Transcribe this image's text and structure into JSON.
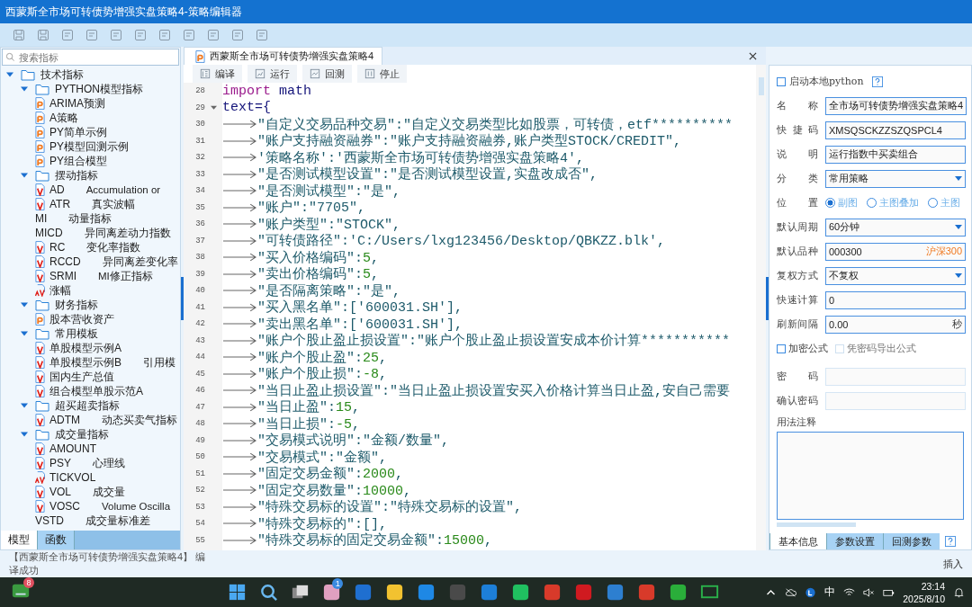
{
  "window": {
    "title": "西蒙斯全市场可转债势增强实盘策略4-策略编辑器"
  },
  "sidebar": {
    "search": {
      "placeholder": "搜索指标"
    },
    "tree": [
      {
        "label": "技术指标",
        "expanded": true,
        "children": [
          {
            "label": "PYTHON模型指标",
            "expanded": true,
            "children": [
              {
                "label": "ARIMA预测",
                "kind": "script"
              },
              {
                "label": "A策略",
                "kind": "script"
              },
              {
                "label": "PY简单示例",
                "kind": "script"
              },
              {
                "label": "PY模型回测示例",
                "kind": "script"
              },
              {
                "label": "PY组合模型",
                "kind": "script"
              }
            ]
          },
          {
            "label": "摆动指标",
            "expanded": true,
            "children": [
              {
                "label": "AD",
                "desc": "Accumulation or",
                "kind": "formula"
              },
              {
                "label": "ATR",
                "desc": "真实波幅",
                "kind": "formula"
              },
              {
                "label": "MI",
                "desc": "动量指标",
                "kind": "plain"
              },
              {
                "label": "MICD",
                "desc": "异同离差动力指数",
                "kind": "plain"
              },
              {
                "label": "RC",
                "desc": "变化率指数",
                "kind": "formula"
              },
              {
                "label": "RCCD",
                "desc": "异同离差变化率",
                "kind": "formula"
              },
              {
                "label": "SRMI",
                "desc": "MI修正指标",
                "kind": "formula"
              },
              {
                "label": "涨幅",
                "kind": "alert"
              }
            ]
          },
          {
            "label": "财务指标",
            "expanded": true,
            "children": [
              {
                "label": "股本营收资产",
                "kind": "script"
              }
            ]
          },
          {
            "label": "常用模板",
            "expanded": true,
            "children": [
              {
                "label": "单股模型示例A",
                "kind": "formula"
              },
              {
                "label": "单股模型示例B",
                "desc": "引用模",
                "kind": "formula"
              },
              {
                "label": "国内生产总值",
                "kind": "formula"
              },
              {
                "label": "组合模型单股示范A",
                "kind": "formula"
              }
            ]
          },
          {
            "label": "超买超卖指标",
            "expanded": true,
            "children": [
              {
                "label": "ADTM",
                "desc": "动态买卖气指标",
                "kind": "formula"
              }
            ]
          },
          {
            "label": "成交量指标",
            "expanded": true,
            "children": [
              {
                "label": "AMOUNT",
                "kind": "formula"
              },
              {
                "label": "PSY",
                "desc": "心理线",
                "kind": "formula"
              },
              {
                "label": "TICKVOL",
                "kind": "alert"
              },
              {
                "label": "VOL",
                "desc": "成交量",
                "kind": "formula"
              },
              {
                "label": "VOSC",
                "desc": "Volume Oscilla",
                "kind": "formula"
              },
              {
                "label": "VSTD",
                "desc": "成交量标准差",
                "kind": "plain"
              }
            ]
          }
        ]
      }
    ],
    "tabs": [
      {
        "label": "模型",
        "selected": true
      },
      {
        "label": "函数",
        "selected": false
      }
    ]
  },
  "editor": {
    "tab": {
      "title": "西蒙斯全市场可转债势增强实盘策略4"
    },
    "toolbar": [
      "编译",
      "运行",
      "回测",
      "停止"
    ],
    "lines": [
      {
        "num": "28",
        "indent": false,
        "parts": [
          {
            "kind": "keyword",
            "text": "import"
          },
          {
            "kind": "ident",
            "text": " math"
          }
        ]
      },
      {
        "num": "29",
        "indent": false,
        "expanded": true,
        "parts": [
          {
            "kind": "ident",
            "text": "text={"
          }
        ]
      },
      {
        "num": "30",
        "indent": true,
        "parts": [
          {
            "kind": "string",
            "text": "\"自定义交易品种交易\":\"自定义交易类型比如股票，可转债，etf**********"
          }
        ]
      },
      {
        "num": "31",
        "indent": true,
        "parts": [
          {
            "kind": "string",
            "text": "\"账户支持融资融券\":\"账户支持融资融券,账户类型STOCK/CREDIT\","
          }
        ]
      },
      {
        "num": "32",
        "indent": true,
        "parts": [
          {
            "kind": "string",
            "text": "'策略名称':'西蒙斯全市场可转债势增强实盘策略4',"
          }
        ]
      },
      {
        "num": "33",
        "indent": true,
        "parts": [
          {
            "kind": "string",
            "text": "\"是否测试模型设置\":\"是否测试模型设置,实盘改成否\","
          }
        ]
      },
      {
        "num": "34",
        "indent": true,
        "parts": [
          {
            "kind": "string",
            "text": "\"是否测试模型\":\"是\","
          }
        ]
      },
      {
        "num": "35",
        "indent": true,
        "parts": [
          {
            "kind": "string",
            "text": "\"账户\":\"7705\","
          }
        ]
      },
      {
        "num": "36",
        "indent": true,
        "parts": [
          {
            "kind": "string",
            "text": "\"账户类型\":\"STOCK\","
          }
        ]
      },
      {
        "num": "37",
        "indent": true,
        "parts": [
          {
            "kind": "string",
            "text": "\"可转债路径\":'C:/Users/lxg123456/Desktop/QBKZZ.blk',"
          }
        ]
      },
      {
        "num": "38",
        "indent": true,
        "parts": [
          {
            "kind": "string",
            "text": "\"买入价格编码\":"
          },
          {
            "kind": "number",
            "text": "5"
          },
          {
            "kind": "string",
            "text": ","
          }
        ]
      },
      {
        "num": "39",
        "indent": true,
        "parts": [
          {
            "kind": "string",
            "text": "\"卖出价格编码\":"
          },
          {
            "kind": "number",
            "text": "5"
          },
          {
            "kind": "string",
            "text": ","
          }
        ]
      },
      {
        "num": "40",
        "indent": true,
        "parts": [
          {
            "kind": "string",
            "text": "\"是否隔离策略\":\"是\","
          }
        ]
      },
      {
        "num": "41",
        "indent": true,
        "parts": [
          {
            "kind": "string",
            "text": "\"买入黑名单\":['600031.SH'],"
          }
        ]
      },
      {
        "num": "42",
        "indent": true,
        "parts": [
          {
            "kind": "string",
            "text": "\"卖出黑名单\":['600031.SH'],"
          }
        ]
      },
      {
        "num": "43",
        "indent": true,
        "parts": [
          {
            "kind": "string",
            "text": "\"账户个股止盈止损设置\":\"账户个股止盈止损设置安成本价计算***********"
          }
        ]
      },
      {
        "num": "44",
        "indent": true,
        "parts": [
          {
            "kind": "string",
            "text": "\"账户个股止盈\":"
          },
          {
            "kind": "number",
            "text": "25"
          },
          {
            "kind": "string",
            "text": ","
          }
        ]
      },
      {
        "num": "45",
        "indent": true,
        "parts": [
          {
            "kind": "string",
            "text": "\"账户个股止损\":"
          },
          {
            "kind": "number",
            "text": "-8"
          },
          {
            "kind": "string",
            "text": ","
          }
        ]
      },
      {
        "num": "46",
        "indent": true,
        "parts": [
          {
            "kind": "string",
            "text": "\"当日止盈止损设置\":\"当日止盈止损设置安买入价格计算当日止盈,安自己需要"
          }
        ]
      },
      {
        "num": "47",
        "indent": true,
        "parts": [
          {
            "kind": "string",
            "text": "\"当日止盈\":"
          },
          {
            "kind": "number",
            "text": "15"
          },
          {
            "kind": "string",
            "text": ","
          }
        ]
      },
      {
        "num": "48",
        "indent": true,
        "parts": [
          {
            "kind": "string",
            "text": "\"当日止损\":"
          },
          {
            "kind": "number",
            "text": "-5"
          },
          {
            "kind": "string",
            "text": ","
          }
        ]
      },
      {
        "num": "49",
        "indent": true,
        "parts": [
          {
            "kind": "string",
            "text": "\"交易模式说明\":\"金额/数量\","
          }
        ]
      },
      {
        "num": "50",
        "indent": true,
        "parts": [
          {
            "kind": "string",
            "text": "\"交易模式\":\"金额\","
          }
        ]
      },
      {
        "num": "51",
        "indent": true,
        "parts": [
          {
            "kind": "string",
            "text": "\"固定交易金额\":"
          },
          {
            "kind": "number",
            "text": "2000"
          },
          {
            "kind": "string",
            "text": ","
          }
        ]
      },
      {
        "num": "52",
        "indent": true,
        "parts": [
          {
            "kind": "string",
            "text": "\"固定交易数量\":"
          },
          {
            "kind": "number",
            "text": "10000"
          },
          {
            "kind": "string",
            "text": ","
          }
        ]
      },
      {
        "num": "53",
        "indent": true,
        "parts": [
          {
            "kind": "string",
            "text": "\"特殊交易标的设置\":\"特殊交易标的设置\","
          }
        ]
      },
      {
        "num": "54",
        "indent": true,
        "parts": [
          {
            "kind": "string",
            "text": "\"特殊交易标的\":[],"
          }
        ]
      },
      {
        "num": "55",
        "indent": true,
        "parts": [
          {
            "kind": "string",
            "text": "\"特殊交易标的固定交易金额\":"
          },
          {
            "kind": "number",
            "text": "15000"
          },
          {
            "kind": "string",
            "text": ","
          }
        ]
      }
    ]
  },
  "panel": {
    "launch_python": {
      "label": "启动本地python",
      "checked": false
    },
    "fields": [
      {
        "kind": "text",
        "label": "名称",
        "value": "全市场可转债势增强实盘策略4"
      },
      {
        "kind": "text",
        "label": "快捷码",
        "value": "XMSQSCKZZSZQSPCL4"
      },
      {
        "kind": "text",
        "label": "说明",
        "value": "运行指数中买卖组合"
      },
      {
        "kind": "select",
        "label": "分类",
        "value": "常用策略"
      },
      {
        "kind": "radio",
        "label": "位置",
        "options": [
          {
            "label": "副图",
            "selected": true
          },
          {
            "label": "主图叠加",
            "selected": false
          },
          {
            "label": "主图",
            "selected": false
          }
        ]
      },
      {
        "kind": "select",
        "label": "默认周期",
        "value": "60分钟"
      },
      {
        "kind": "text",
        "label": "默认品种",
        "value": "000300",
        "suffix": "沪深300"
      },
      {
        "kind": "select",
        "label": "复权方式",
        "value": "不复权"
      },
      {
        "kind": "text",
        "label": "快速计算",
        "value": "0"
      },
      {
        "kind": "text",
        "label": "刷新间隔",
        "value": "0.00",
        "suffix": "秒"
      }
    ],
    "checks": [
      {
        "label": "加密公式",
        "checked": false,
        "disabled": false
      },
      {
        "label": "凭密码导出公式",
        "checked": false,
        "disabled": true
      }
    ],
    "secure_fields": [
      {
        "label": "密码",
        "disabled": true
      },
      {
        "label": "确认密码",
        "disabled": true
      }
    ],
    "notes": {
      "label": "用法注释"
    },
    "tabs": [
      {
        "label": "基本信息",
        "selected": true
      },
      {
        "label": "参数设置",
        "selected": false
      },
      {
        "label": "回测参数",
        "selected": false
      }
    ]
  },
  "status_bar": {
    "lines": [
      "【西蒙斯全市场可转债势增强实盘策略4】 编",
      "译成功"
    ],
    "mode": "插入"
  },
  "taskbar": {
    "widget_badge": "8",
    "store_badge": "1",
    "ime": "中",
    "time": "23:14",
    "date": "2025/8/10"
  }
}
